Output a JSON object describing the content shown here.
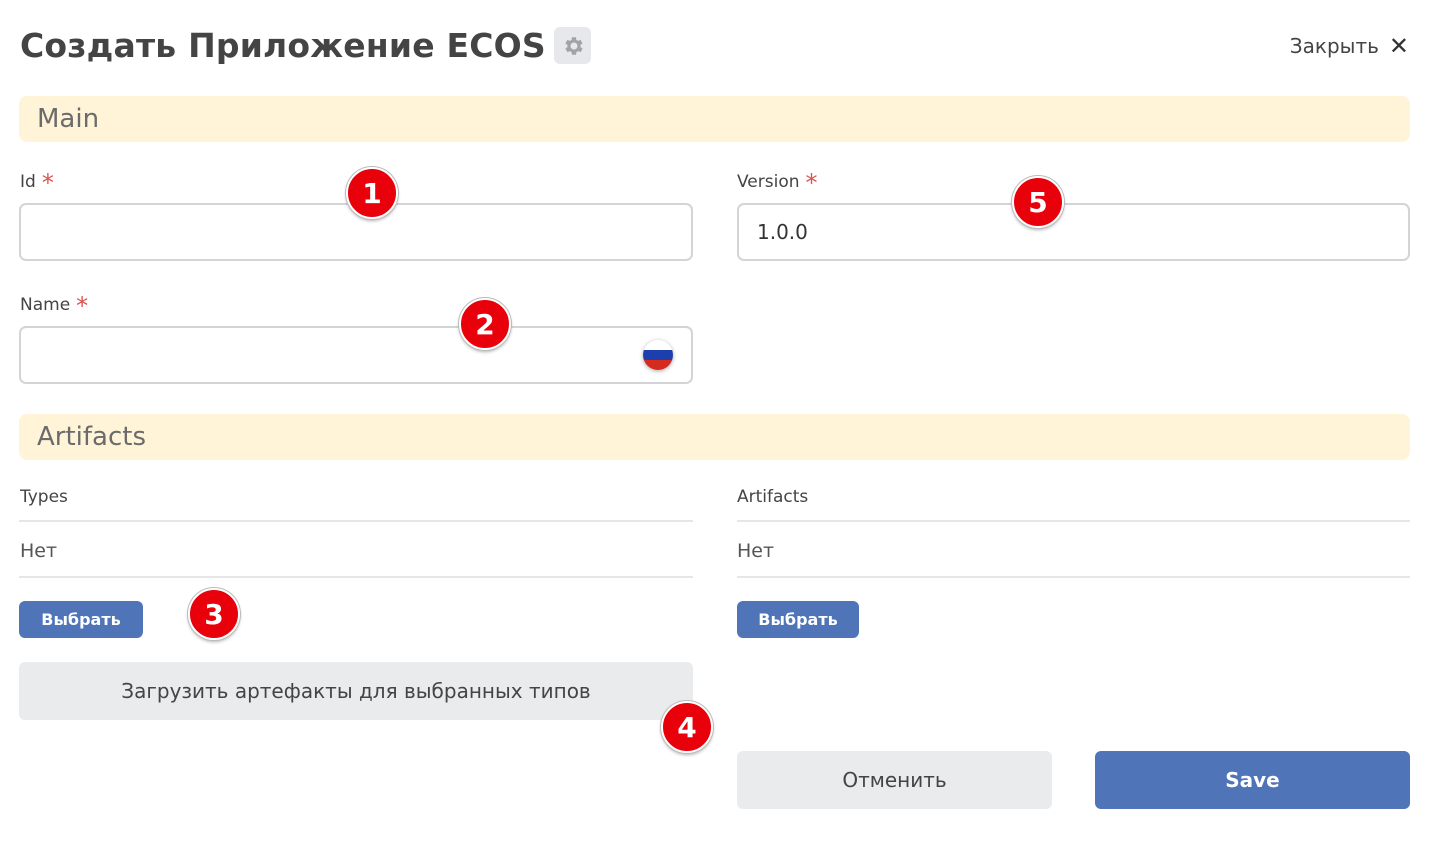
{
  "header": {
    "title": "Создать Приложение ECOS",
    "close_label": "Закрыть",
    "close_icon": "✕"
  },
  "sections": {
    "main": "Main",
    "artifacts": "Artifacts"
  },
  "fields": {
    "id": {
      "label": "Id",
      "required_mark": "*",
      "value": ""
    },
    "version": {
      "label": "Version",
      "required_mark": "*",
      "value": "1.0.0"
    },
    "name": {
      "label": "Name",
      "required_mark": "*",
      "value": "",
      "locale_icon": "russia-flag-icon"
    }
  },
  "artifacts": {
    "types": {
      "label": "Types",
      "value": "Нет",
      "button": "Выбрать"
    },
    "artifacts": {
      "label": "Artifacts",
      "value": "Нет",
      "button": "Выбрать"
    },
    "load_button": "Загрузить артефакты для выбранных типов"
  },
  "footer": {
    "cancel": "Отменить",
    "save": "Save"
  },
  "markers": [
    "1",
    "2",
    "3",
    "4",
    "5"
  ],
  "colors": {
    "section_bg": "#fff4d8",
    "primary": "#4f74b8",
    "required": "#d9534f",
    "marker": "#e8000b"
  }
}
